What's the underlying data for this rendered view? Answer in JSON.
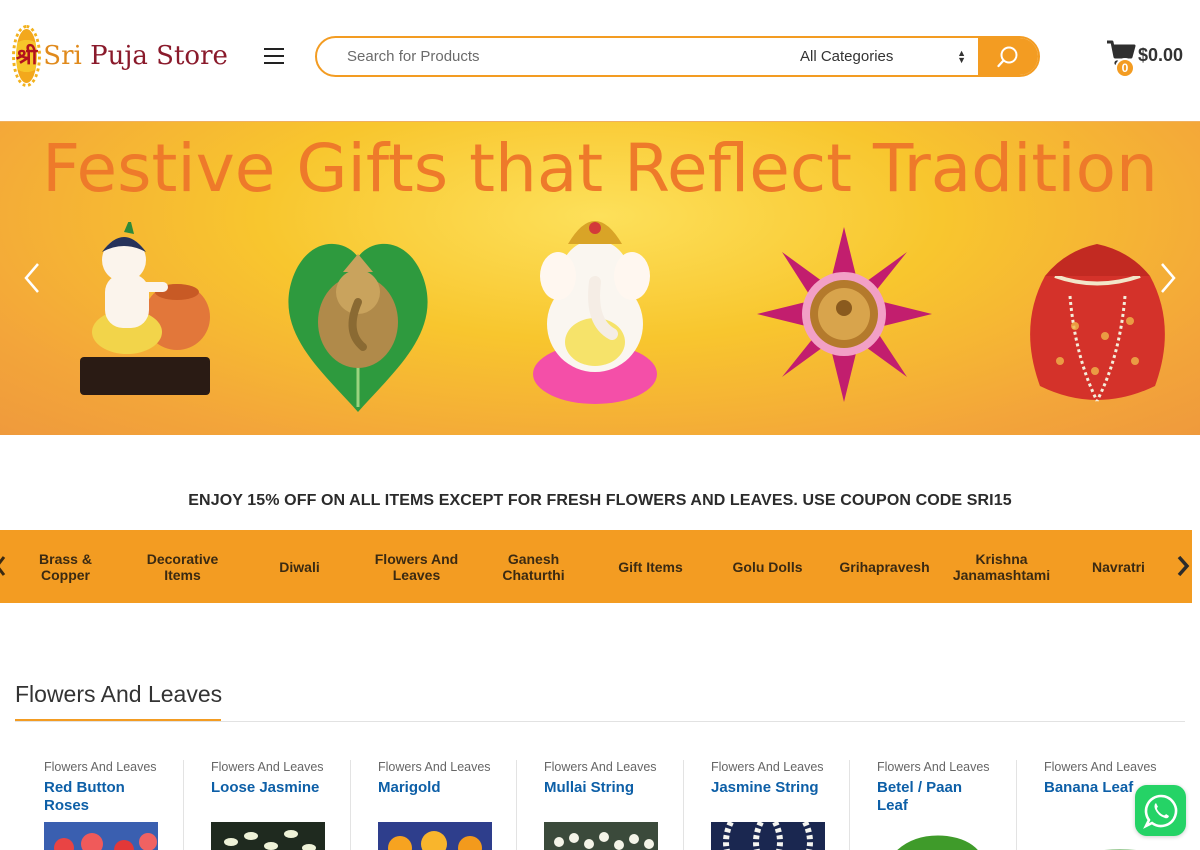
{
  "header": {
    "logo_glyph": "श्री",
    "logo_name_part1": "Sri",
    "logo_name_part2": " Puja Store",
    "search_placeholder": "Search for Products",
    "category_select": "All Categories",
    "cart_count": "0",
    "cart_total": "$0.00"
  },
  "banner": {
    "title": "Festive Gifts that Reflect Tradition"
  },
  "coupon_text": "ENJOY 15% OFF ON ALL ITEMS EXCEPT FOR FRESH FLOWERS AND LEAVES. USE COUPON CODE SRI15",
  "categories": [
    "Brass & Copper",
    "Decorative Items",
    "Diwali",
    "Flowers And Leaves",
    "Ganesh Chaturthi",
    "Gift Items",
    "Golu Dolls",
    "Grihapravesh",
    "Krishna Janamashtami",
    "Navratri"
  ],
  "section": {
    "title": "Flowers And Leaves"
  },
  "products": [
    {
      "category": "Flowers And Leaves",
      "name": "Red Button Roses"
    },
    {
      "category": "Flowers And Leaves",
      "name": "Loose Jasmine"
    },
    {
      "category": "Flowers And Leaves",
      "name": "Marigold"
    },
    {
      "category": "Flowers And Leaves",
      "name": "Mullai String"
    },
    {
      "category": "Flowers And Leaves",
      "name": "Jasmine String"
    },
    {
      "category": "Flowers And Leaves",
      "name": "Betel / Paan Leaf"
    },
    {
      "category": "Flowers And Leaves",
      "name": "Banana Leaf"
    }
  ],
  "colors": {
    "accent": "#f39c22",
    "link": "#0d5fa7",
    "banner_title": "#ee7a2a",
    "whatsapp": "#25d366"
  }
}
